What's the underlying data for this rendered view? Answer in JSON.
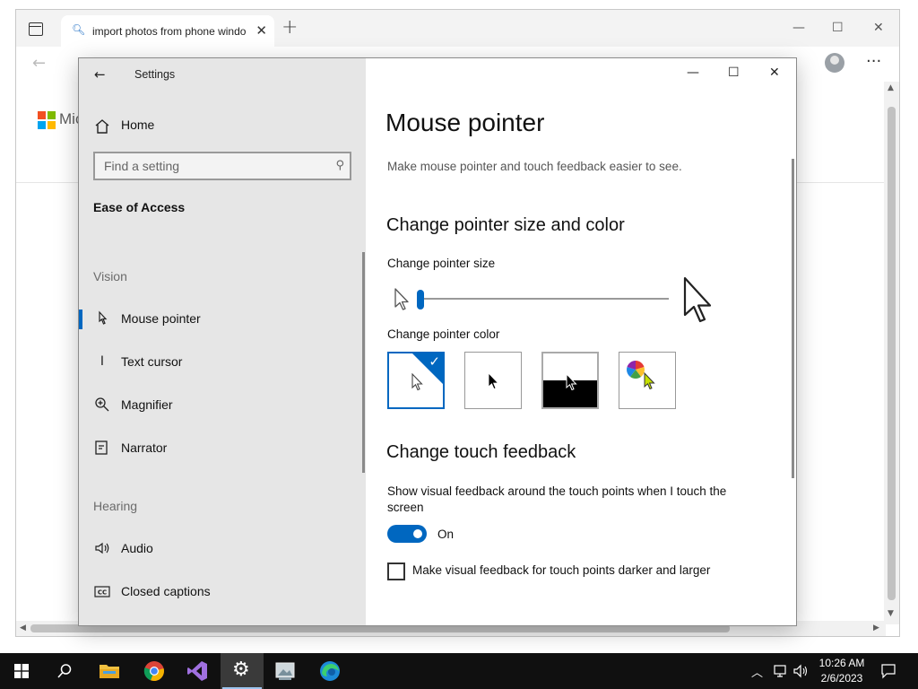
{
  "browser": {
    "tab_title": "import photos from phone windo",
    "tab_close": "✕",
    "new_tab": "+",
    "window_controls": {
      "minimize": "—",
      "maximize": "☐",
      "close": "✕"
    },
    "back_arrow": "←",
    "more_menu": "···",
    "brand_text": "Mic",
    "brand_colors": [
      "#f25022",
      "#7fba00",
      "#00a4ef",
      "#ffb900"
    ]
  },
  "settings": {
    "title": "Settings",
    "back_arrow": "←",
    "window_controls": {
      "minimize": "—",
      "maximize": "☐",
      "close": "✕"
    },
    "home_label": "Home",
    "search_placeholder": "Find a setting",
    "category": "Ease of Access",
    "sections": {
      "vision": "Vision",
      "hearing": "Hearing"
    },
    "nav_items": [
      {
        "label": "Mouse pointer",
        "icon": "mouse-pointer-icon",
        "active": true
      },
      {
        "label": "Text cursor",
        "icon": "text-cursor-icon",
        "active": false
      },
      {
        "label": "Magnifier",
        "icon": "magnifier-icon",
        "active": false
      },
      {
        "label": "Narrator",
        "icon": "narrator-icon",
        "active": false
      },
      {
        "label": "Audio",
        "icon": "audio-icon",
        "active": false
      },
      {
        "label": "Closed captions",
        "icon": "closed-captions-icon",
        "active": false
      }
    ],
    "page": {
      "title": "Mouse pointer",
      "description": "Make mouse pointer and touch feedback easier to see.",
      "pointer_heading": "Change pointer size and color",
      "size_label": "Change pointer size",
      "size_value": 1,
      "color_label": "Change pointer color",
      "color_options": [
        {
          "name": "white",
          "selected": true
        },
        {
          "name": "black",
          "selected": false
        },
        {
          "name": "inverted",
          "selected": false
        },
        {
          "name": "custom",
          "selected": false
        }
      ],
      "touch_heading": "Change touch feedback",
      "touch_description": "Show visual feedback around the touch points when I touch the screen",
      "toggle_state": "On",
      "checkbox_label": "Make visual feedback for touch points darker and larger",
      "checkbox_checked": false
    },
    "accent_color": "#0067c0"
  },
  "taskbar": {
    "apps": [
      "start",
      "search",
      "file-explorer",
      "chrome",
      "visual-studio",
      "settings",
      "photos",
      "edge"
    ],
    "active_app": "settings",
    "time": "10:26 AM",
    "date": "2/6/2023"
  }
}
